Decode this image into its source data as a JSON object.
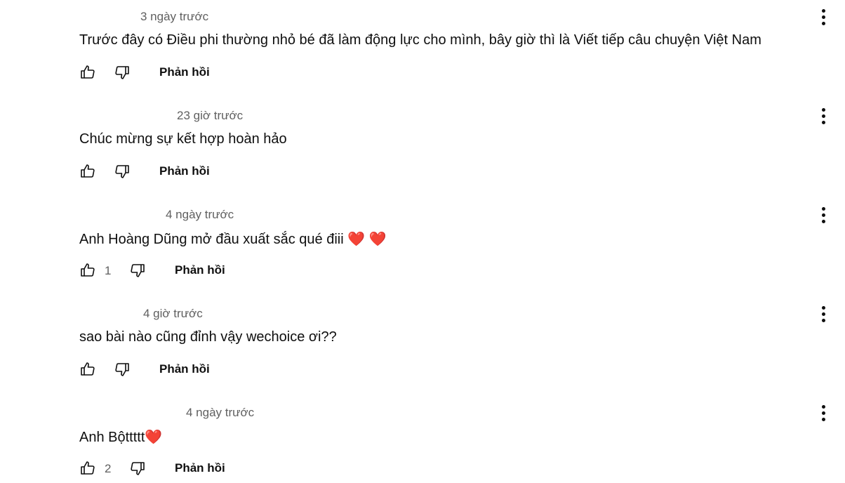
{
  "comments": [
    {
      "timestamp": "3 ngày trước",
      "text": "Trước đây có Điều phi thường nhỏ bé đã làm động lực cho mình, bây giờ thì là Viết tiếp câu chuyện Việt Nam",
      "hearts": [],
      "like_count": "",
      "reply_label": "Phản hồi"
    },
    {
      "timestamp": "23 giờ trước",
      "text": "Chúc mừng sự kết hợp hoàn hảo",
      "hearts": [],
      "like_count": "",
      "reply_label": "Phản hồi"
    },
    {
      "timestamp": "4 ngày trước",
      "text": "Anh Hoàng Dũng mở đầu xuất sắc qué điii",
      "hearts": [
        "❤️",
        "❤️"
      ],
      "like_count": "1",
      "reply_label": "Phản hồi"
    },
    {
      "timestamp": "4 giờ trước",
      "text": "sao bài nào cũng đỉnh vậy wechoice ơi??",
      "hearts": [],
      "like_count": "",
      "reply_label": "Phản hồi"
    },
    {
      "timestamp": "4 ngày trước",
      "text": "Anh Bộttttt",
      "hearts": [
        "❤️"
      ],
      "like_count": "2",
      "reply_label": "Phản hồi"
    }
  ],
  "icons": {
    "like": "thumb-up-outline-icon",
    "dislike": "thumb-down-outline-icon",
    "more": "more-vertical-icon"
  },
  "colors": {
    "text": "#0f0f0f",
    "secondary": "#606060",
    "heart": "#e0245e",
    "background": "#ffffff"
  }
}
